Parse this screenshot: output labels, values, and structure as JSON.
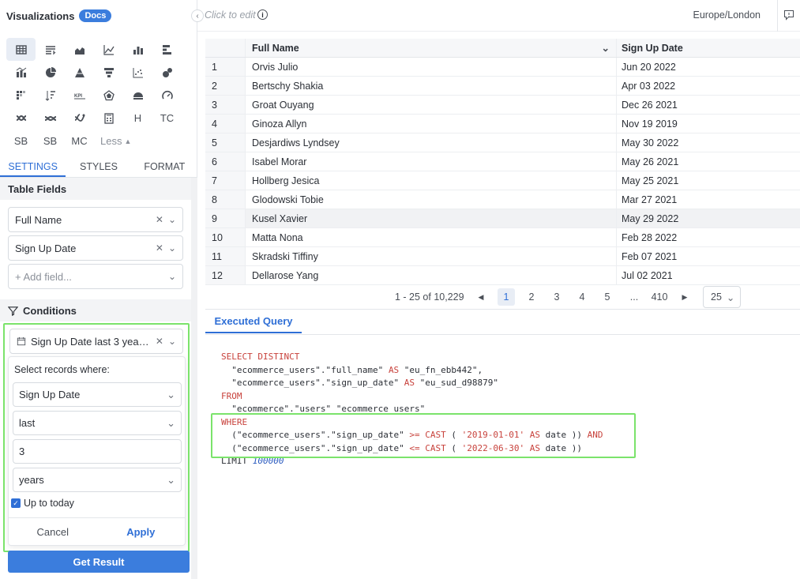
{
  "app": {
    "title": "Visualizations",
    "docs_badge": "Docs"
  },
  "chart_types": {
    "row1": [
      "table-icon",
      "pivot-icon",
      "area-icon",
      "line-icon",
      "bar-icon",
      "horizontal-bar-icon"
    ],
    "text_items": {
      "h": "H",
      "tc": "TC",
      "sb1": "SB",
      "sb2": "SB",
      "mc": "MC",
      "less": "Less"
    }
  },
  "tabs": [
    "SETTINGS",
    "STYLES",
    "FORMAT"
  ],
  "table_fields": {
    "heading": "Table Fields",
    "fields": [
      "Full Name",
      "Sign Up Date"
    ],
    "add_placeholder": "+ Add field..."
  },
  "conditions": {
    "heading": "Conditions",
    "chip": "Sign Up Date last 3 years ...",
    "popup": {
      "label": "Select records where:",
      "field": "Sign Up Date",
      "operator": "last",
      "amount": "3",
      "unit": "years",
      "up_to_today": "Up to today",
      "cancel": "Cancel",
      "apply": "Apply"
    }
  },
  "get_result": "Get Result",
  "topbar": {
    "click_to_edit": "Click to edit",
    "info": "i",
    "timezone": "Europe/London"
  },
  "table": {
    "columns": [
      "Full Name",
      "Sign Up Date"
    ],
    "rows": [
      {
        "n": "1",
        "name": "Orvis Julio",
        "date": "Jun 20 2022"
      },
      {
        "n": "2",
        "name": "Bertschy Shakia",
        "date": "Apr 03 2022"
      },
      {
        "n": "3",
        "name": "Groat Ouyang",
        "date": "Dec 26 2021"
      },
      {
        "n": "4",
        "name": "Ginoza Allyn",
        "date": "Nov 19 2019"
      },
      {
        "n": "5",
        "name": "Desjardiws Lyndsey",
        "date": "May 30 2022"
      },
      {
        "n": "6",
        "name": "Isabel Morar",
        "date": "May 26 2021"
      },
      {
        "n": "7",
        "name": "Hollberg Jesica",
        "date": "May 25 2021"
      },
      {
        "n": "8",
        "name": "Glodowski Tobie",
        "date": "Mar 27 2021"
      },
      {
        "n": "9",
        "name": "Kusel Xavier",
        "date": "May 29 2022"
      },
      {
        "n": "10",
        "name": "Matta Nona",
        "date": "Feb 28 2022"
      },
      {
        "n": "11",
        "name": "Skradski Tiffiny",
        "date": "Feb 07 2021"
      },
      {
        "n": "12",
        "name": "Dellarose Yang",
        "date": "Jul 02 2021"
      }
    ]
  },
  "pager": {
    "range": "1 - 25 of 10,229",
    "pages": [
      "1",
      "2",
      "3",
      "4",
      "5",
      "...",
      "410"
    ],
    "current": "1",
    "page_size": "25"
  },
  "query": {
    "tab": "Executed Query",
    "select": "SELECT DISTINCT",
    "line1_a": "\"ecommerce_users\".\"full_name\" ",
    "line1_as": "AS",
    "line1_b": " \"eu_fn_ebb442\",",
    "line2_a": "\"ecommerce_users\".\"sign_up_date\" ",
    "line2_as": "AS",
    "line2_b": " \"eu_sud_d98879\"",
    "from": "FROM",
    "from_table": "\"ecommerce\".\"users\" \"ecommerce_users\"",
    "where": "WHERE",
    "cond1_a": "(\"ecommerce_users\".\"sign_up_date\" ",
    "cond1_op": ">=",
    "cond1_cast": "CAST",
    "cond1_val": "'2019-01-01'",
    "cond1_as": "AS",
    "cond1_b": " date )) ",
    "and": "AND",
    "cond2_a": "(\"ecommerce_users\".\"sign_up_date\" ",
    "cond2_op": "<=",
    "cond2_cast": "CAST",
    "cond2_val": "'2022-06-30'",
    "cond2_as": "AS",
    "cond2_b": " date ))",
    "limit": "LIMIT",
    "limit_val": "100000"
  },
  "colors": {
    "accent": "#3b7ddd",
    "highlight": "#7be36b",
    "keyword": "#c8423c"
  }
}
